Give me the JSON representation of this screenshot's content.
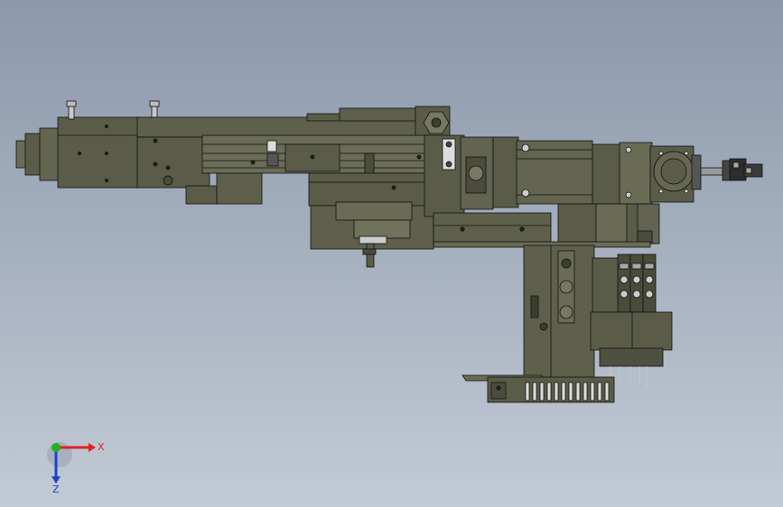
{
  "viewport": {
    "background_top": "#8c99ab",
    "background_bottom": "#c2cad5"
  },
  "model": {
    "body_color": "#5b5c48",
    "dark_color": "#3f4032",
    "light_color": "#7b7c63",
    "edge_color": "#111111"
  },
  "triad": {
    "x_label": "X",
    "z_label": "Z",
    "x_color": "#e02020",
    "y_color": "#20b020",
    "z_color": "#2040d0"
  }
}
